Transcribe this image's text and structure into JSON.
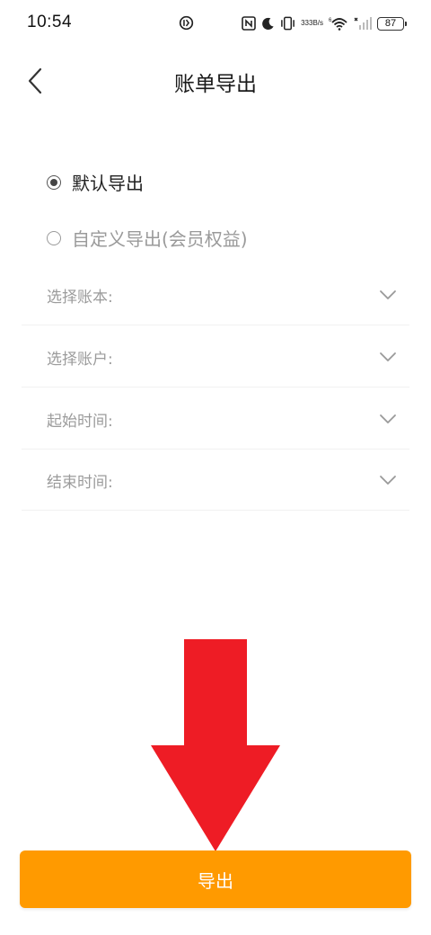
{
  "status_bar": {
    "time": "10:54",
    "net_speed_value": "333",
    "net_speed_unit": "B/s",
    "battery": "87",
    "icons": [
      "data-saver-icon",
      "nfc-icon",
      "moon-icon",
      "vibrate-icon",
      "wifi-icon",
      "signal-icon",
      "battery-icon"
    ]
  },
  "header": {
    "title": "账单导出",
    "back_icon": "chevron-left-icon"
  },
  "export_mode": {
    "options": [
      {
        "label": "默认导出",
        "selected": true
      },
      {
        "label": "自定义导出(会员权益)",
        "selected": false
      }
    ]
  },
  "filters": {
    "items": [
      {
        "label": "选择账本:"
      },
      {
        "label": "选择账户:"
      },
      {
        "label": "起始时间:"
      },
      {
        "label": "结束时间:"
      }
    ],
    "chevron_icon": "chevron-down-icon"
  },
  "overlay": {
    "arrow_icon": "red-down-arrow-icon",
    "arrow_color": "#ee1c25"
  },
  "footer": {
    "export_label": "导出",
    "button_color": "#ff9a00"
  }
}
